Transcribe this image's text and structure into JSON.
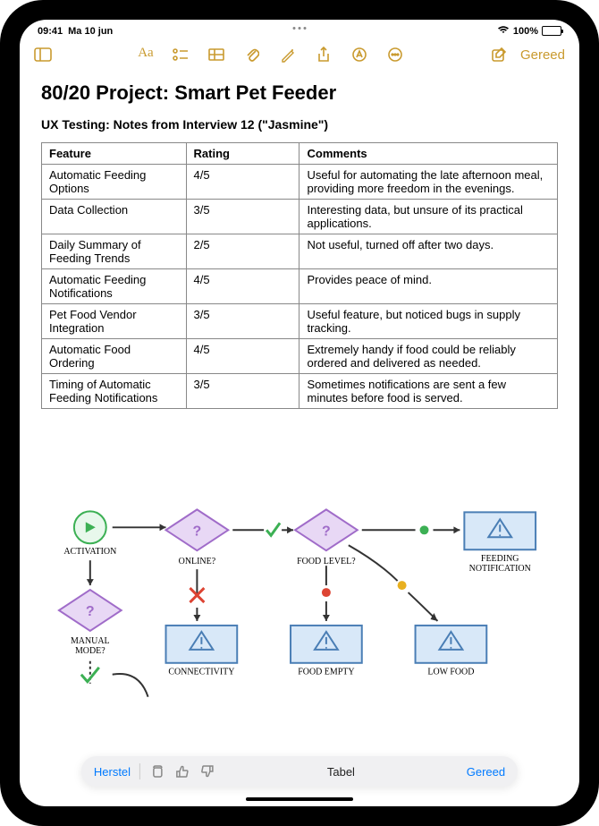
{
  "status": {
    "time": "09:41",
    "date": "Ma 10 jun",
    "battery_pct": "100%"
  },
  "toolbar": {
    "done_label": "Gereed"
  },
  "note": {
    "title": "80/20 Project: Smart Pet Feeder",
    "subtitle": "UX Testing: Notes from Interview 12 (\"Jasmine\")"
  },
  "table": {
    "headers": {
      "feature": "Feature",
      "rating": "Rating",
      "comments": "Comments"
    },
    "rows": [
      {
        "feature": "Automatic Feeding Options",
        "rating": "4/5",
        "comments": "Useful for automating the late afternoon meal, providing more freedom in the evenings."
      },
      {
        "feature": "Data Collection",
        "rating": "3/5",
        "comments": "Interesting data, but unsure of its practical applications."
      },
      {
        "feature": "Daily Summary of Feeding Trends",
        "rating": "2/5",
        "comments": "Not useful, turned off after two days."
      },
      {
        "feature": "Automatic Feeding Notifications",
        "rating": "4/5",
        "comments": "Provides peace of mind."
      },
      {
        "feature": "Pet Food Vendor Integration",
        "rating": "3/5",
        "comments": "Useful feature, but noticed bugs in supply tracking."
      },
      {
        "feature": "Automatic Food Ordering",
        "rating": "4/5",
        "comments": "Extremely handy if food could be reliably ordered and delivered as needed."
      },
      {
        "feature": "Timing of Automatic Feeding Notifications",
        "rating": "3/5",
        "comments": "Sometimes notifications are sent a few minutes before food is served."
      }
    ]
  },
  "flowchart": {
    "nodes": {
      "activation": "ACTIVATION",
      "online": "ONLINE?",
      "manual": "MANUAL MODE?",
      "connectivity": "CONNECTIVITY",
      "food_level": "FOOD LEVEL?",
      "food_empty": "FOOD EMPTY",
      "low_food": "LOW FOOD",
      "feeding_notif": "FEEDING NOTIFICATION"
    }
  },
  "bottombar": {
    "restore": "Herstel",
    "center_label": "Tabel",
    "done": "Gereed"
  }
}
